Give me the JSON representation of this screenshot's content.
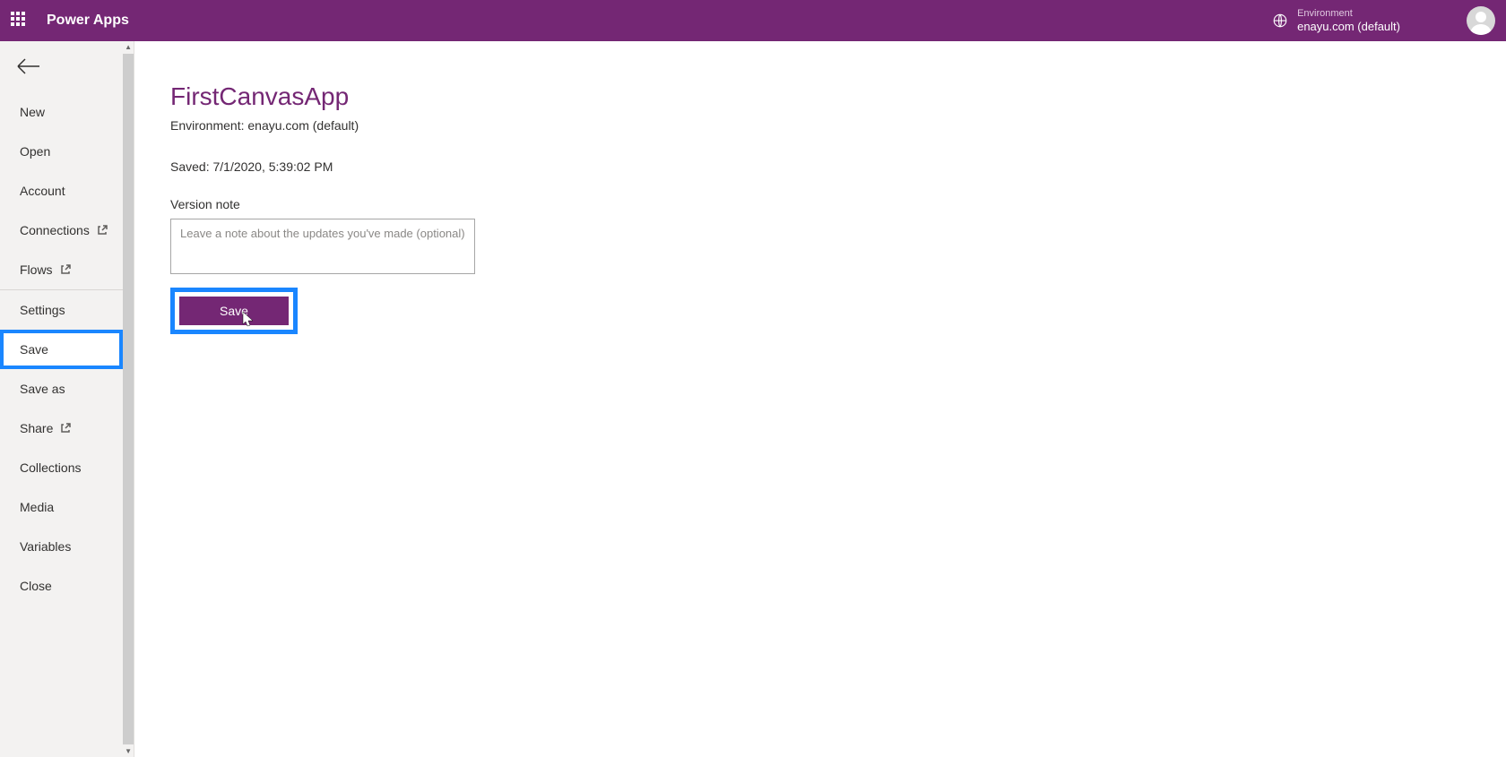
{
  "header": {
    "app_title": "Power Apps",
    "environment_label": "Environment",
    "environment_name": "enayu.com (default)"
  },
  "sidebar": {
    "items": [
      {
        "label": "New",
        "popout": false
      },
      {
        "label": "Open",
        "popout": false
      },
      {
        "label": "Account",
        "popout": false
      },
      {
        "label": "Connections",
        "popout": true
      },
      {
        "label": "Flows",
        "popout": true
      },
      {
        "label": "Settings",
        "popout": false
      },
      {
        "label": "Save",
        "popout": false
      },
      {
        "label": "Save as",
        "popout": false
      },
      {
        "label": "Share",
        "popout": true
      },
      {
        "label": "Collections",
        "popout": false
      },
      {
        "label": "Media",
        "popout": false
      },
      {
        "label": "Variables",
        "popout": false
      },
      {
        "label": "Close",
        "popout": false
      }
    ]
  },
  "main": {
    "app_name": "FirstCanvasApp",
    "environment_line": "Environment: enayu.com (default)",
    "saved_line": "Saved: 7/1/2020, 5:39:02 PM",
    "version_note_label": "Version note",
    "version_note_placeholder": "Leave a note about the updates you've made (optional)",
    "version_note_value": "",
    "save_button_label": "Save"
  },
  "highlight": {
    "sidebar_highlight_index": 6,
    "divider_after_index": 4
  },
  "colors": {
    "brand": "#742774",
    "highlight": "#1a86ff"
  }
}
